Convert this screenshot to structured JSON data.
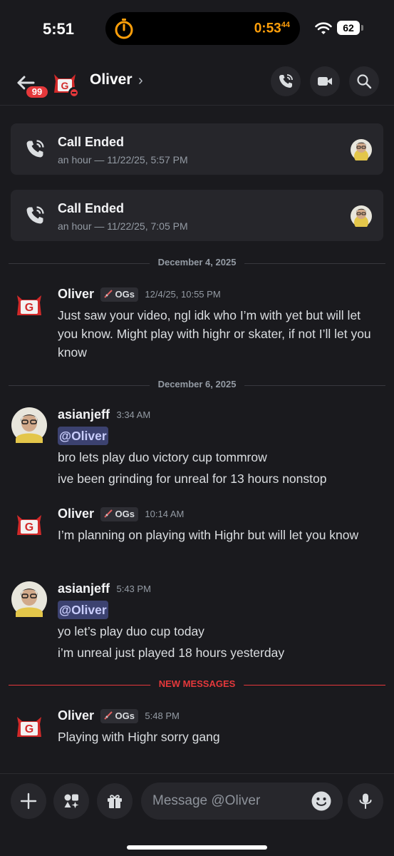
{
  "status_bar": {
    "time": "5:51",
    "timer": "0:53",
    "timer_fraction": "44",
    "battery": "62",
    "icons": [
      "stopwatch-icon",
      "wifi-icon",
      "battery-icon"
    ]
  },
  "header": {
    "back_icon": "arrow-left-icon",
    "unread_badge": "99",
    "title": "Oliver",
    "chevron": "›",
    "actions": [
      "voice-call-icon",
      "video-call-icon",
      "search-icon"
    ],
    "status": "do-not-disturb"
  },
  "calls": [
    {
      "title": "Call Ended",
      "subtitle": "an hour — 11/22/25, 5:57 PM"
    },
    {
      "title": "Call Ended",
      "subtitle": "an hour — 11/22/25, 7:05 PM"
    }
  ],
  "dividers": {
    "d1": "December 4, 2025",
    "d2": "December 6, 2025",
    "new": "NEW MESSAGES"
  },
  "messages": [
    {
      "author": "Oliver",
      "tag": "OGs",
      "time": "12/4/25, 10:55 PM",
      "lines": [
        "Just saw your video, ngl idk who I’m with yet but will let you know. Might play with highr or skater, if not I’ll let you know"
      ]
    },
    {
      "author": "asianjeff",
      "time": "3:34 AM",
      "mention": "@Oliver",
      "lines": [
        "bro lets play duo victory cup tommrow",
        "ive been grinding for unreal for 13 hours nonstop"
      ]
    },
    {
      "author": "Oliver",
      "tag": "OGs",
      "time": "10:14 AM",
      "lines": [
        "I’m planning on playing with Highr but will let you know"
      ]
    },
    {
      "author": "asianjeff",
      "time": "5:43 PM",
      "mention": "@Oliver",
      "lines": [
        "yo let’s play duo cup today",
        "i’m unreal just played 18 hours yesterday"
      ]
    },
    {
      "author": "Oliver",
      "tag": "OGs",
      "time": "5:48 PM",
      "lines": [
        "Playing with Highr sorry gang"
      ]
    }
  ],
  "composer": {
    "placeholder": "Message @Oliver",
    "buttons": [
      "plus-icon",
      "apps-icon",
      "gift-icon"
    ],
    "emoji_icon": "emoji-icon",
    "mic_icon": "mic-icon"
  },
  "colors": {
    "background": "#1a1a1e",
    "card": "#26262b",
    "accent_red": "#e5383b",
    "mention_bg": "#3c4270",
    "timer_orange": "#ff9f0a"
  }
}
